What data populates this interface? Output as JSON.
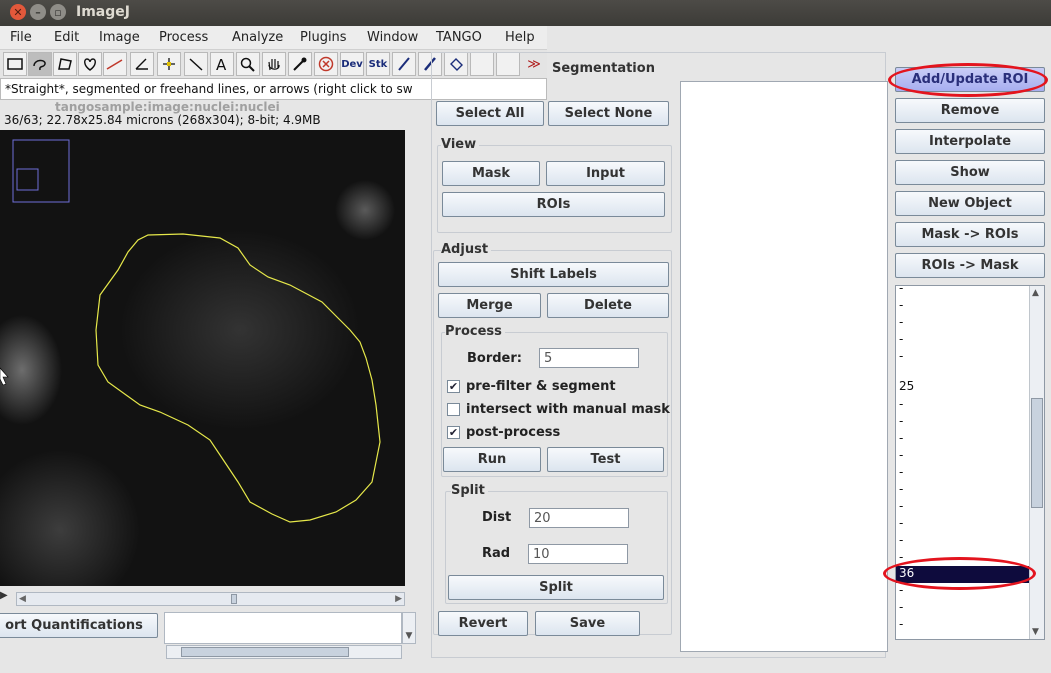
{
  "window": {
    "title": "ImageJ",
    "menu": [
      "File",
      "Edit",
      "Image",
      "Process",
      "Analyze",
      "Plugins",
      "Window",
      "TANGO",
      "Help"
    ],
    "status_text": "*Straight*, segmented or freehand lines, or arrows (right click to sw"
  },
  "toolbar_icons": [
    "rectangle-tool-icon",
    "freehand-tool-icon",
    "polygon-tool-icon",
    "oval-tool-icon",
    "line-tool-icon",
    "angle-tool-icon",
    "point-tool-icon",
    "wand-tool-icon",
    "text-tool-icon",
    "magnifier-icon",
    "hand-icon",
    "color-picker-icon",
    "close-circle-icon",
    "dev-menu-icon",
    "stk-menu-icon",
    "pencil-icon",
    "brush-icon",
    "flood-fill-icon",
    "blank-tool-1",
    "blank-tool-2",
    "more-tools-icon"
  ],
  "toolbar_text": {
    "dev": "Dev",
    "stk": "Stk"
  },
  "image_window": {
    "info": "36/63; 22.78x25.84 microns (268x304); 8-bit; 4.9MB",
    "overlay_text": "tangosample:image:nuclei:nuclei"
  },
  "bottom_left": {
    "export_button": "ort Quantifications"
  },
  "segmentation": {
    "title": "Segmentation",
    "select_all": "Select All",
    "select_none": "Select None",
    "view": {
      "title": "View",
      "mask": "Mask",
      "input": "Input",
      "rois": "ROIs"
    },
    "adjust": {
      "title": "Adjust",
      "shift_labels": "Shift Labels",
      "merge": "Merge",
      "delete": "Delete"
    },
    "process": {
      "title": "Process",
      "border_label": "Border:",
      "border_value": "5",
      "prefilter": "pre-filter & segment",
      "intersect": "intersect with manual mask",
      "postprocess": "post-process",
      "run": "Run",
      "test": "Test"
    },
    "split": {
      "title": "Split",
      "dist_label": "Dist",
      "dist_value": "20",
      "rad_label": "Rad",
      "rad_value": "10",
      "split_button": "Split"
    },
    "revert": "Revert",
    "save": "Save"
  },
  "roi_panel": {
    "add_update": "Add/Update ROI",
    "remove": "Remove",
    "interpolate": "Interpolate",
    "show": "Show",
    "new_object": "New Object",
    "mask_to_rois": "Mask -> ROIs",
    "rois_to_mask": "ROIs -> Mask",
    "list": [
      "-",
      "-",
      "-",
      "-",
      "-",
      "25",
      "-",
      "-",
      "-",
      "-",
      "-",
      "-",
      "-",
      "-",
      "-",
      "-",
      "36",
      "-",
      "-",
      "-",
      "-"
    ],
    "selected": "36"
  },
  "colors": {
    "highlight": "#e3141e",
    "roi_outline": "#e6e84a",
    "selection": "#0e0b3d",
    "active_button": "#a7aef0"
  }
}
